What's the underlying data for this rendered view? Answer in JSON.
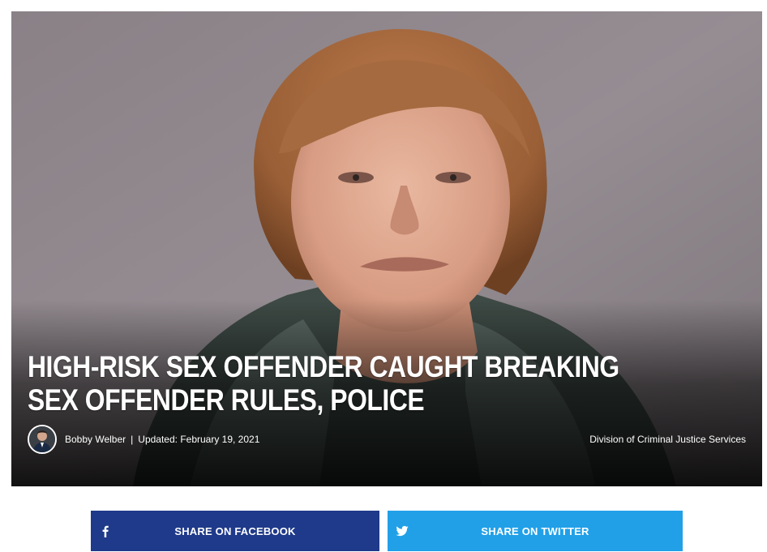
{
  "article": {
    "headline": "HIGH-RISK SEX OFFENDER CAUGHT BREAKING SEX OFFENDER RULES, POLICE",
    "author": "Bobby Welber",
    "separator": "|",
    "updated": "Updated: February 19, 2021",
    "photo_credit": "Division of Criminal Justice Services"
  },
  "share": {
    "facebook_label": "SHARE ON FACEBOOK",
    "twitter_label": "SHARE ON TWITTER",
    "facebook_icon": "facebook-icon",
    "twitter_icon": "twitter-icon"
  },
  "colors": {
    "facebook": "#1f3a8a",
    "twitter": "#21a0e8",
    "headline_text": "#ffffff"
  }
}
